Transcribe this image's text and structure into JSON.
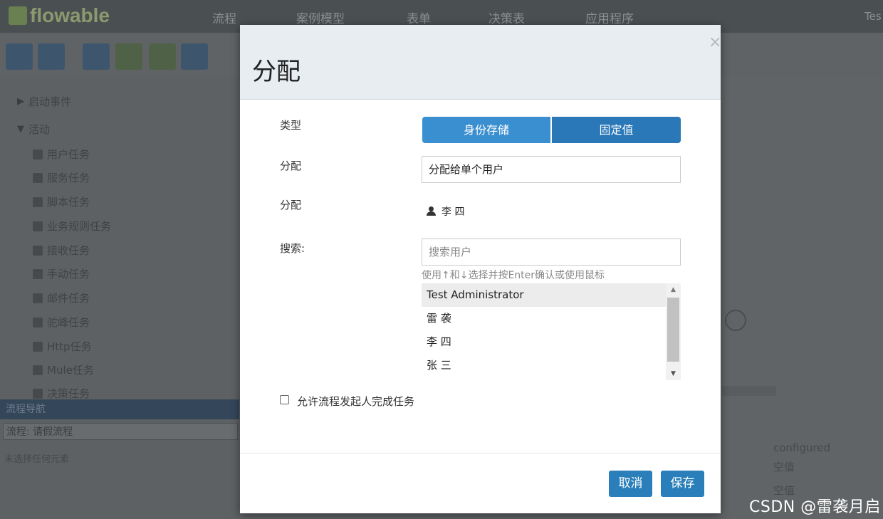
{
  "app": {
    "logo": "flowable",
    "nav_tabs": [
      "流程",
      "案例模型",
      "表单",
      "决策表",
      "应用程序"
    ],
    "user_corner": "Tes"
  },
  "palette": {
    "items": [
      {
        "label": "启动事件",
        "icon": "chevron-right-icon"
      },
      {
        "label": "活动",
        "icon": "chevron-down-icon"
      },
      {
        "label": "用户任务",
        "icon": "user-icon"
      },
      {
        "label": "服务任务",
        "icon": "gear-icon"
      },
      {
        "label": "脚本任务",
        "icon": "script-icon"
      },
      {
        "label": "业务规则任务",
        "icon": "table-icon"
      },
      {
        "label": "接收任务",
        "icon": "inbox-icon"
      },
      {
        "label": "手动任务",
        "icon": "hand-icon"
      },
      {
        "label": "邮件任务",
        "icon": "envelope-icon"
      },
      {
        "label": "驼峰任务",
        "icon": "camel-icon"
      },
      {
        "label": "Http任务",
        "icon": "send-icon"
      },
      {
        "label": "Mule任务",
        "icon": "mule-icon"
      },
      {
        "label": "决策任务",
        "icon": "table-icon"
      }
    ]
  },
  "process_nav": {
    "header": "流程导航",
    "select_value": "流程: 请假流程",
    "note": "未选择任何元素"
  },
  "properties_bg": {
    "text_1": "configured",
    "text_2": "空值",
    "text_3": "空值"
  },
  "modal": {
    "title": "分配",
    "close_symbol": "×",
    "labels": {
      "type": "类型",
      "assignment": "分配",
      "assignee": "分配",
      "search": "搜索:"
    },
    "type_options": [
      "身份存储",
      "固定值"
    ],
    "assignment_select": "分配给单个用户",
    "assignee_value": "李 四",
    "search_placeholder": "搜索用户",
    "search_help": "使用↑和↓选择并按Enter确认或使用鼠标",
    "users": [
      "Test Administrator",
      "雷 袭",
      "李 四",
      "张 三"
    ],
    "selected_user_index": 0,
    "checkbox_label": "允许流程发起人完成任务",
    "checkbox_checked": false,
    "buttons": {
      "cancel": "取消",
      "save": "保存"
    }
  },
  "watermark": "CSDN @雷袭月启",
  "colors": {
    "overlay_topbar": "#4a4f52",
    "primary_button": "#2a7fba",
    "toggle_active": "#3a8fd0",
    "toggle_inactive": "#2a78b8",
    "modal_header": "#e8edf2"
  }
}
